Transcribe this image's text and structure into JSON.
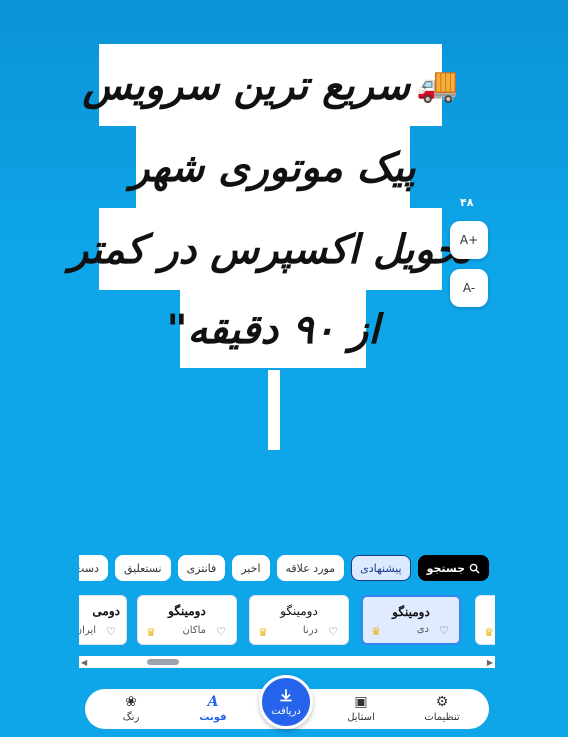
{
  "canvas": {
    "lines": [
      "سریع ترین سرویس",
      "پیک موتوری شهر",
      "تحویل اکسپرس در کمتر",
      "از ۹۰ دقیقه\""
    ],
    "line1_emoji": "🚚"
  },
  "size_controls": {
    "value": "۴۸",
    "increase_label": "A+",
    "decrease_label": "A-"
  },
  "filters": [
    {
      "label": "جستجو",
      "type": "search"
    },
    {
      "label": "پیشنهادی",
      "active": true
    },
    {
      "label": "مورد علاقه"
    },
    {
      "label": "اخیر"
    },
    {
      "label": "فانتزی"
    },
    {
      "label": "نستعلیق"
    },
    {
      "label": "دست‌نویس"
    }
  ],
  "font_cards": [
    {
      "title": "دومینگو",
      "subtitle": "دی",
      "selected": true
    },
    {
      "title": "دومینگو",
      "subtitle": "درنا"
    },
    {
      "title": "دومینگو",
      "subtitle": "ماکان"
    },
    {
      "title": "دومی",
      "subtitle": "ایران"
    }
  ],
  "bottom_nav": {
    "settings": "تنظیمات",
    "style": "استایل",
    "download": "دریافت",
    "font": "فونت",
    "color": "رنگ"
  },
  "colors": {
    "background": "#0ea5e9",
    "accent": "#2563eb",
    "crown": "#eab308"
  }
}
